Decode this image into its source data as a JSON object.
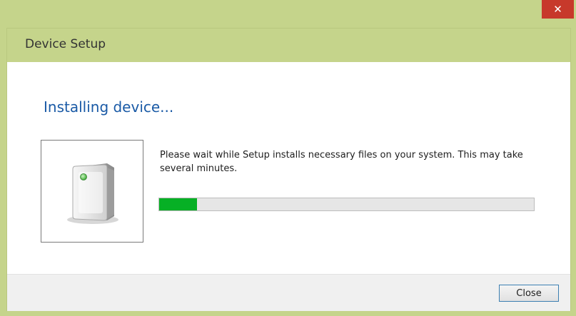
{
  "titlebar": {
    "close_glyph": "✕"
  },
  "dialog": {
    "header_title": "Device Setup",
    "heading": "Installing device...",
    "message": "Please wait while Setup installs necessary files on your system. This may take several minutes.",
    "device_icon": "external-drive-icon",
    "progress_fraction": 0.1,
    "close_label": "Close"
  },
  "colors": {
    "frame": "#c5d48b",
    "heading": "#1a5aa6",
    "progress_fill": "#06b025",
    "close_x": "#c7392b"
  }
}
